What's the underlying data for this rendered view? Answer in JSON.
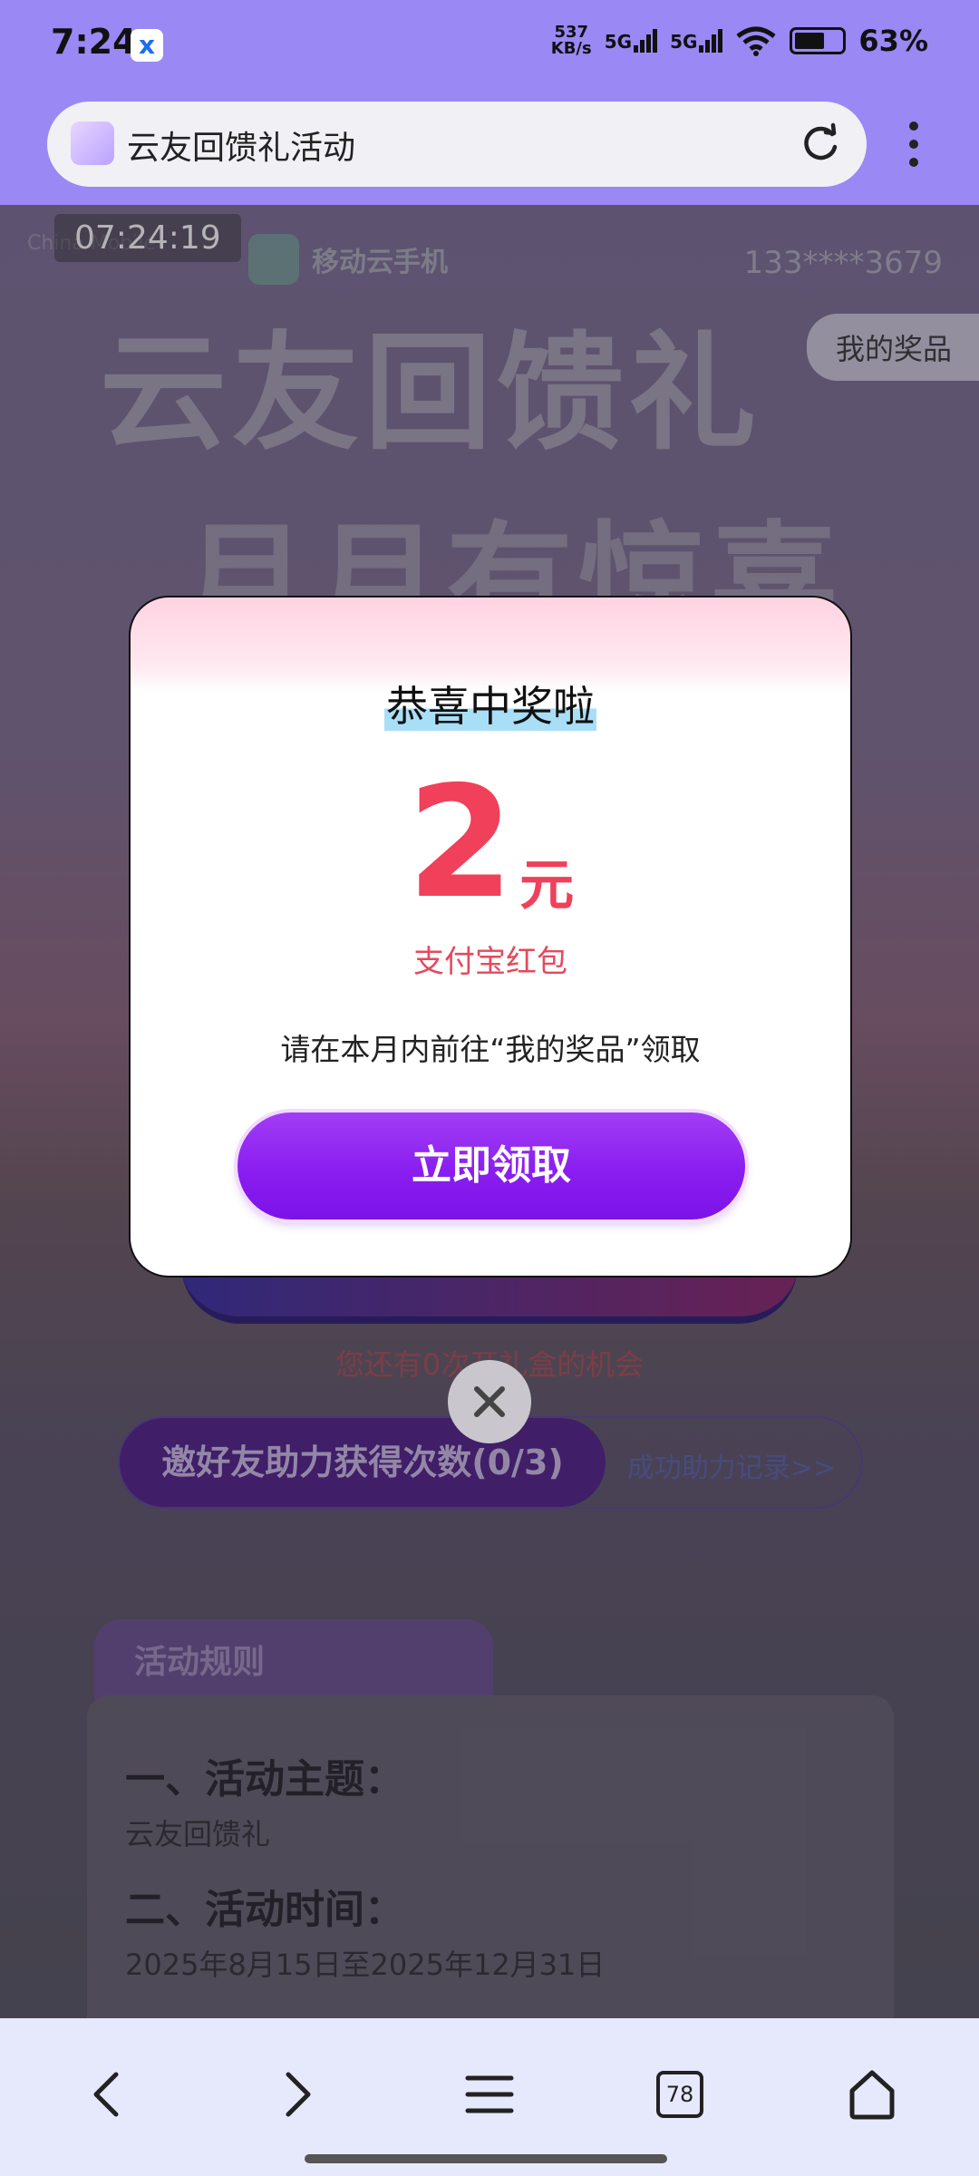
{
  "status_bar": {
    "time": "7:24",
    "net_speed_top": "537",
    "net_speed_bottom": "KB/s",
    "sig1": "5G",
    "sig2": "5G",
    "battery": "63%"
  },
  "browser": {
    "page_title": "云友回馈礼活动",
    "tabs_count": "78"
  },
  "page": {
    "timer": "07:24:19",
    "carrier_logo": "China Mobile",
    "app_name": "移动云手机",
    "phone_number": "133****3679",
    "my_prizes": "我的奖品",
    "hero_line1": "云友回馈礼",
    "hero_line2": "月月有惊喜",
    "chance_text": "您还有0次开礼盒的机会",
    "invite_button": "邀好友助力获得次数(0/3)",
    "help_record_link": "成功助力记录>>",
    "rules_tab": "活动规则",
    "rules": [
      {
        "heading": "一、活动主题：",
        "text": "云友回馈礼"
      },
      {
        "heading": "二、活动时间：",
        "text": "2025年8月15日至2025年12月31日"
      }
    ]
  },
  "modal": {
    "title": "恭喜中奖啦",
    "amount": "2",
    "unit": "元",
    "prize_name": "支付宝红包",
    "hint": "请在本月内前往“我的奖品”领取",
    "claim_button": "立即领取"
  },
  "colors": {
    "accent_purple": "#8a1ef0",
    "prize_red": "#f0405a",
    "browser_bar": "#9a88f4"
  }
}
